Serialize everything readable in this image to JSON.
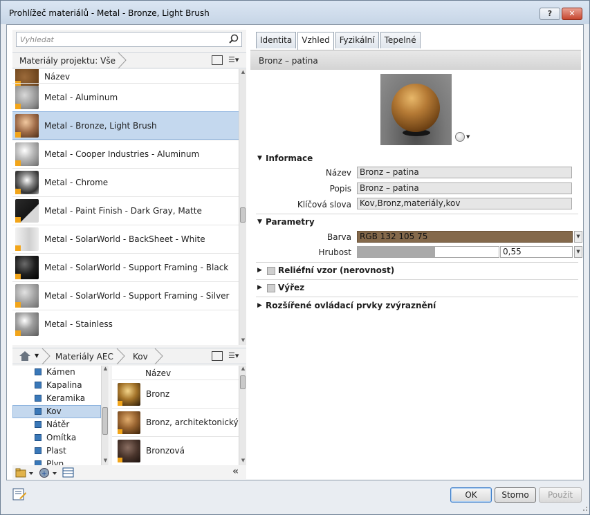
{
  "window": {
    "title": "Prohlížeč materiálů - Metal - Bronze, Light Brush",
    "help": "?",
    "close": "✕"
  },
  "search": {
    "placeholder": "Vyhledat"
  },
  "project_crumb": {
    "label": "Materiály projektu: Vše"
  },
  "project_list": {
    "column_header": "Název",
    "items": [
      {
        "name": "Metal - Aluminum"
      },
      {
        "name": "Metal - Bronze, Light Brush",
        "selected": true
      },
      {
        "name": "Metal - Cooper Industries - Aluminum"
      },
      {
        "name": "Metal - Chrome"
      },
      {
        "name": "Metal - Paint Finish - Dark Gray, Matte"
      },
      {
        "name": "Metal - SolarWorld - BackSheet - White"
      },
      {
        "name": "Metal - SolarWorld - Support Framing - Black"
      },
      {
        "name": "Metal - SolarWorld - Support Framing - Silver"
      },
      {
        "name": "Metal - Stainless"
      }
    ]
  },
  "library_crumb": {
    "items": [
      "Materiály AEC",
      "Kov"
    ]
  },
  "library_tree": [
    "Kámen",
    "Kapalina",
    "Keramika",
    "Kov",
    "Nátěr",
    "Omítka",
    "Plast",
    "Plyn"
  ],
  "library_list": {
    "column_header": "Název",
    "items": [
      "Bronz",
      "Bronz, architektonický",
      "Bronzová"
    ]
  },
  "tabs": [
    {
      "label": "Identita"
    },
    {
      "label": "Vzhled",
      "active": true
    },
    {
      "label": "Fyzikální"
    },
    {
      "label": "Tepelné"
    }
  ],
  "asset_name": "Bronz – patina",
  "info": {
    "title": "Informace",
    "name_label": "Název",
    "name_value": "Bronz – patina",
    "desc_label": "Popis",
    "desc_value": "Bronz – patina",
    "keywords_label": "Klíčová slova",
    "keywords_value": "Kov,Bronz,materiály,kov"
  },
  "params": {
    "title": "Parametry",
    "color_label": "Barva",
    "color_value": "RGB 132 105 75",
    "color_hex": "#84694b",
    "roughness_label": "Hrubost",
    "roughness_value": "0,55",
    "roughness_fraction": 0.55
  },
  "sections": {
    "relief": "Reliéfní vzor (nerovnost)",
    "cutout": "Výřez",
    "advanced": "Rozšířené ovládací prvky zvýraznění"
  },
  "buttons": {
    "ok": "OK",
    "cancel": "Storno",
    "apply": "Použít"
  }
}
